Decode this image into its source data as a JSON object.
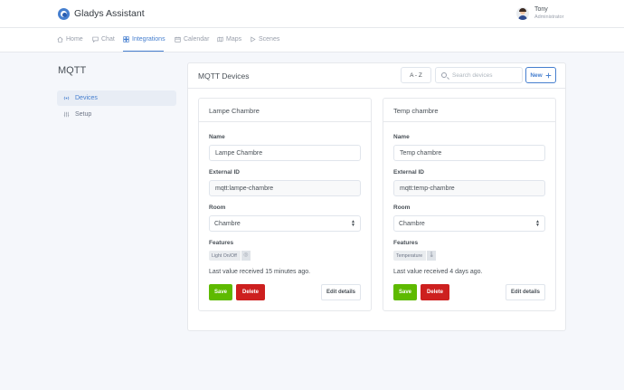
{
  "app": {
    "name": "Gladys Assistant"
  },
  "user": {
    "name": "Tony",
    "role": "Administrator"
  },
  "nav": {
    "items": [
      {
        "label": "Home",
        "icon": "home-icon"
      },
      {
        "label": "Chat",
        "icon": "chat-icon"
      },
      {
        "label": "Integrations",
        "icon": "grid-icon",
        "active": true
      },
      {
        "label": "Calendar",
        "icon": "calendar-icon"
      },
      {
        "label": "Maps",
        "icon": "map-icon"
      },
      {
        "label": "Scenes",
        "icon": "play-icon"
      }
    ]
  },
  "sidebar": {
    "title": "MQTT",
    "items": [
      {
        "label": "Devices",
        "icon": "radio-icon",
        "active": true
      },
      {
        "label": "Setup",
        "icon": "sliders-icon"
      }
    ]
  },
  "devices_panel": {
    "title": "MQTT Devices",
    "sort": "A - Z",
    "search_placeholder": "Search devices",
    "new_label": "New"
  },
  "labels": {
    "name": "Name",
    "external_id": "External ID",
    "room": "Room",
    "features": "Features",
    "save": "Save",
    "delete": "Delete",
    "edit": "Edit details"
  },
  "devices": [
    {
      "title": "Lampe Chambre",
      "name": "Lampe Chambre",
      "external_id": "mqtt:lampe-chambre",
      "room": "Chambre",
      "feature": "Light On/Off",
      "feature_icon": "toggle-icon",
      "last_value": "Last value received 15 minutes ago."
    },
    {
      "title": "Temp chambre",
      "name": "Temp chambre",
      "external_id": "mqtt:temp-chambre",
      "room": "Chambre",
      "feature": "Temperature",
      "feature_icon": "thermometer-icon",
      "last_value": "Last value received 4 days ago."
    }
  ],
  "colors": {
    "accent": "#467fcf",
    "save": "#5eba00",
    "delete": "#cd201f",
    "background": "#f5f7fb"
  }
}
